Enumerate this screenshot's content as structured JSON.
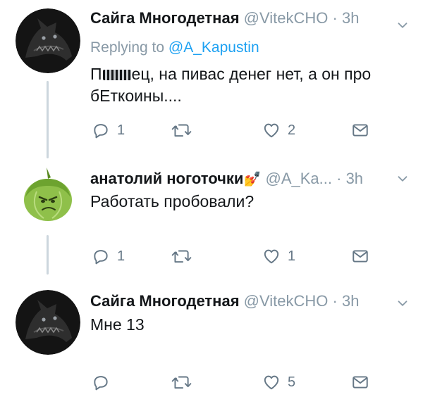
{
  "tweets": [
    {
      "author": "Сайга Многодетная",
      "handle": "@VitekCHO",
      "time": "3h",
      "replying_label": "Replying to",
      "replying_to": "@A_Kapustin",
      "text_prefix": "П",
      "text_rest": "ец, на пивас денег нет, а он про",
      "text_line2": "бЕткоины....",
      "replies": "1",
      "retweets": "",
      "likes": "2",
      "avatar": "wolf-avatar"
    },
    {
      "author": "анатолий ноготочки",
      "author_emoji": "💅",
      "handle": "@A_Ka...",
      "time": "3h",
      "text": "Работать пробовали?",
      "replies": "1",
      "retweets": "",
      "likes": "1",
      "avatar": "cabbage-avatar"
    },
    {
      "author": "Сайга Многодетная",
      "handle": "@VitekCHO",
      "time": "3h",
      "text": "Мне 13",
      "replies": "",
      "retweets": "",
      "likes": "5",
      "avatar": "wolf-avatar"
    }
  ],
  "separator": "·",
  "icons": {
    "reply": "reply-icon",
    "retweet": "retweet-icon",
    "like": "heart-icon",
    "message": "dm-icon",
    "caret": "chevron-down-icon"
  },
  "colors": {
    "text": "#14171a",
    "muted": "#8899a6",
    "link": "#1da1f2",
    "thread_line": "#ccd6dd"
  }
}
